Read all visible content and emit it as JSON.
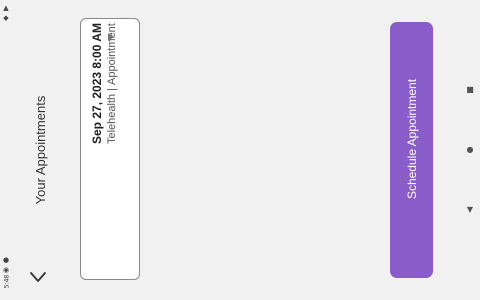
{
  "status_bar": {
    "time": "5:48"
  },
  "page": {
    "title": "Your Appointments"
  },
  "appointment": {
    "date_time": "Sep 27, 2023 8:00 AM",
    "type": "Telehealth",
    "separator": "|",
    "kind": "Appointment"
  },
  "actions": {
    "schedule_label": "Schedule Appointment"
  },
  "colors": {
    "accent": "#8a5cc9",
    "background": "#f1f1f1"
  }
}
